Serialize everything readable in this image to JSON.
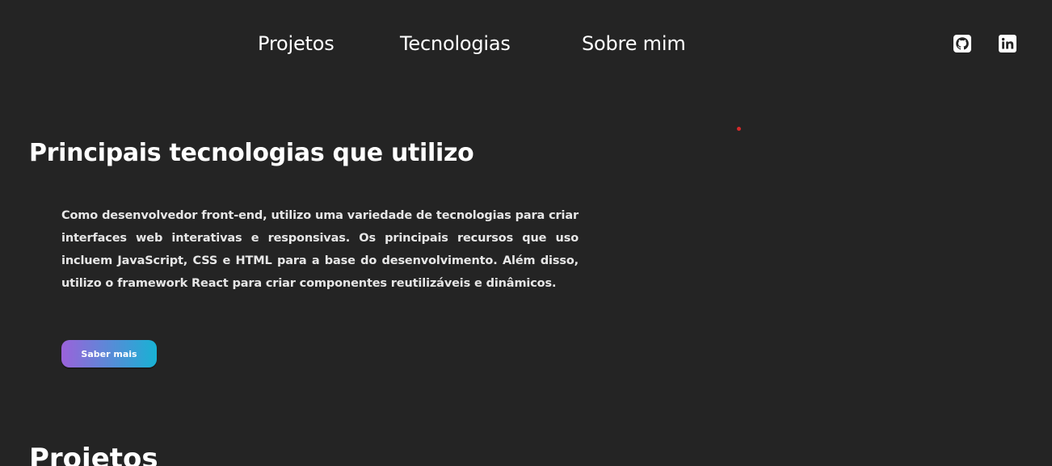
{
  "nav": {
    "items": [
      {
        "label": "Projetos"
      },
      {
        "label": "Tecnologias"
      },
      {
        "label": "Sobre mim"
      }
    ],
    "social": [
      {
        "icon": "github-icon"
      },
      {
        "icon": "linkedin-icon"
      }
    ]
  },
  "tech_section": {
    "title": "Principais tecnologias que utilizo",
    "description": "Como desenvolvedor front-end, utilizo uma variedade de tecnologias para criar interfaces web interativas e responsivas. Os principais recursos que uso incluem JavaScript, CSS e HTML para a base do desenvolvimento. Além disso, utilizo o framework React para criar componentes reutilizáveis e dinâmicos.",
    "button_label": "Saber mais"
  },
  "projects_section": {
    "title": "Projetos"
  },
  "colors": {
    "background": "#242424",
    "text": "#ffffff",
    "button_gradient_start": "#9b62da",
    "button_gradient_end": "#18b2d4",
    "accent_dot": "#d42a2a"
  }
}
